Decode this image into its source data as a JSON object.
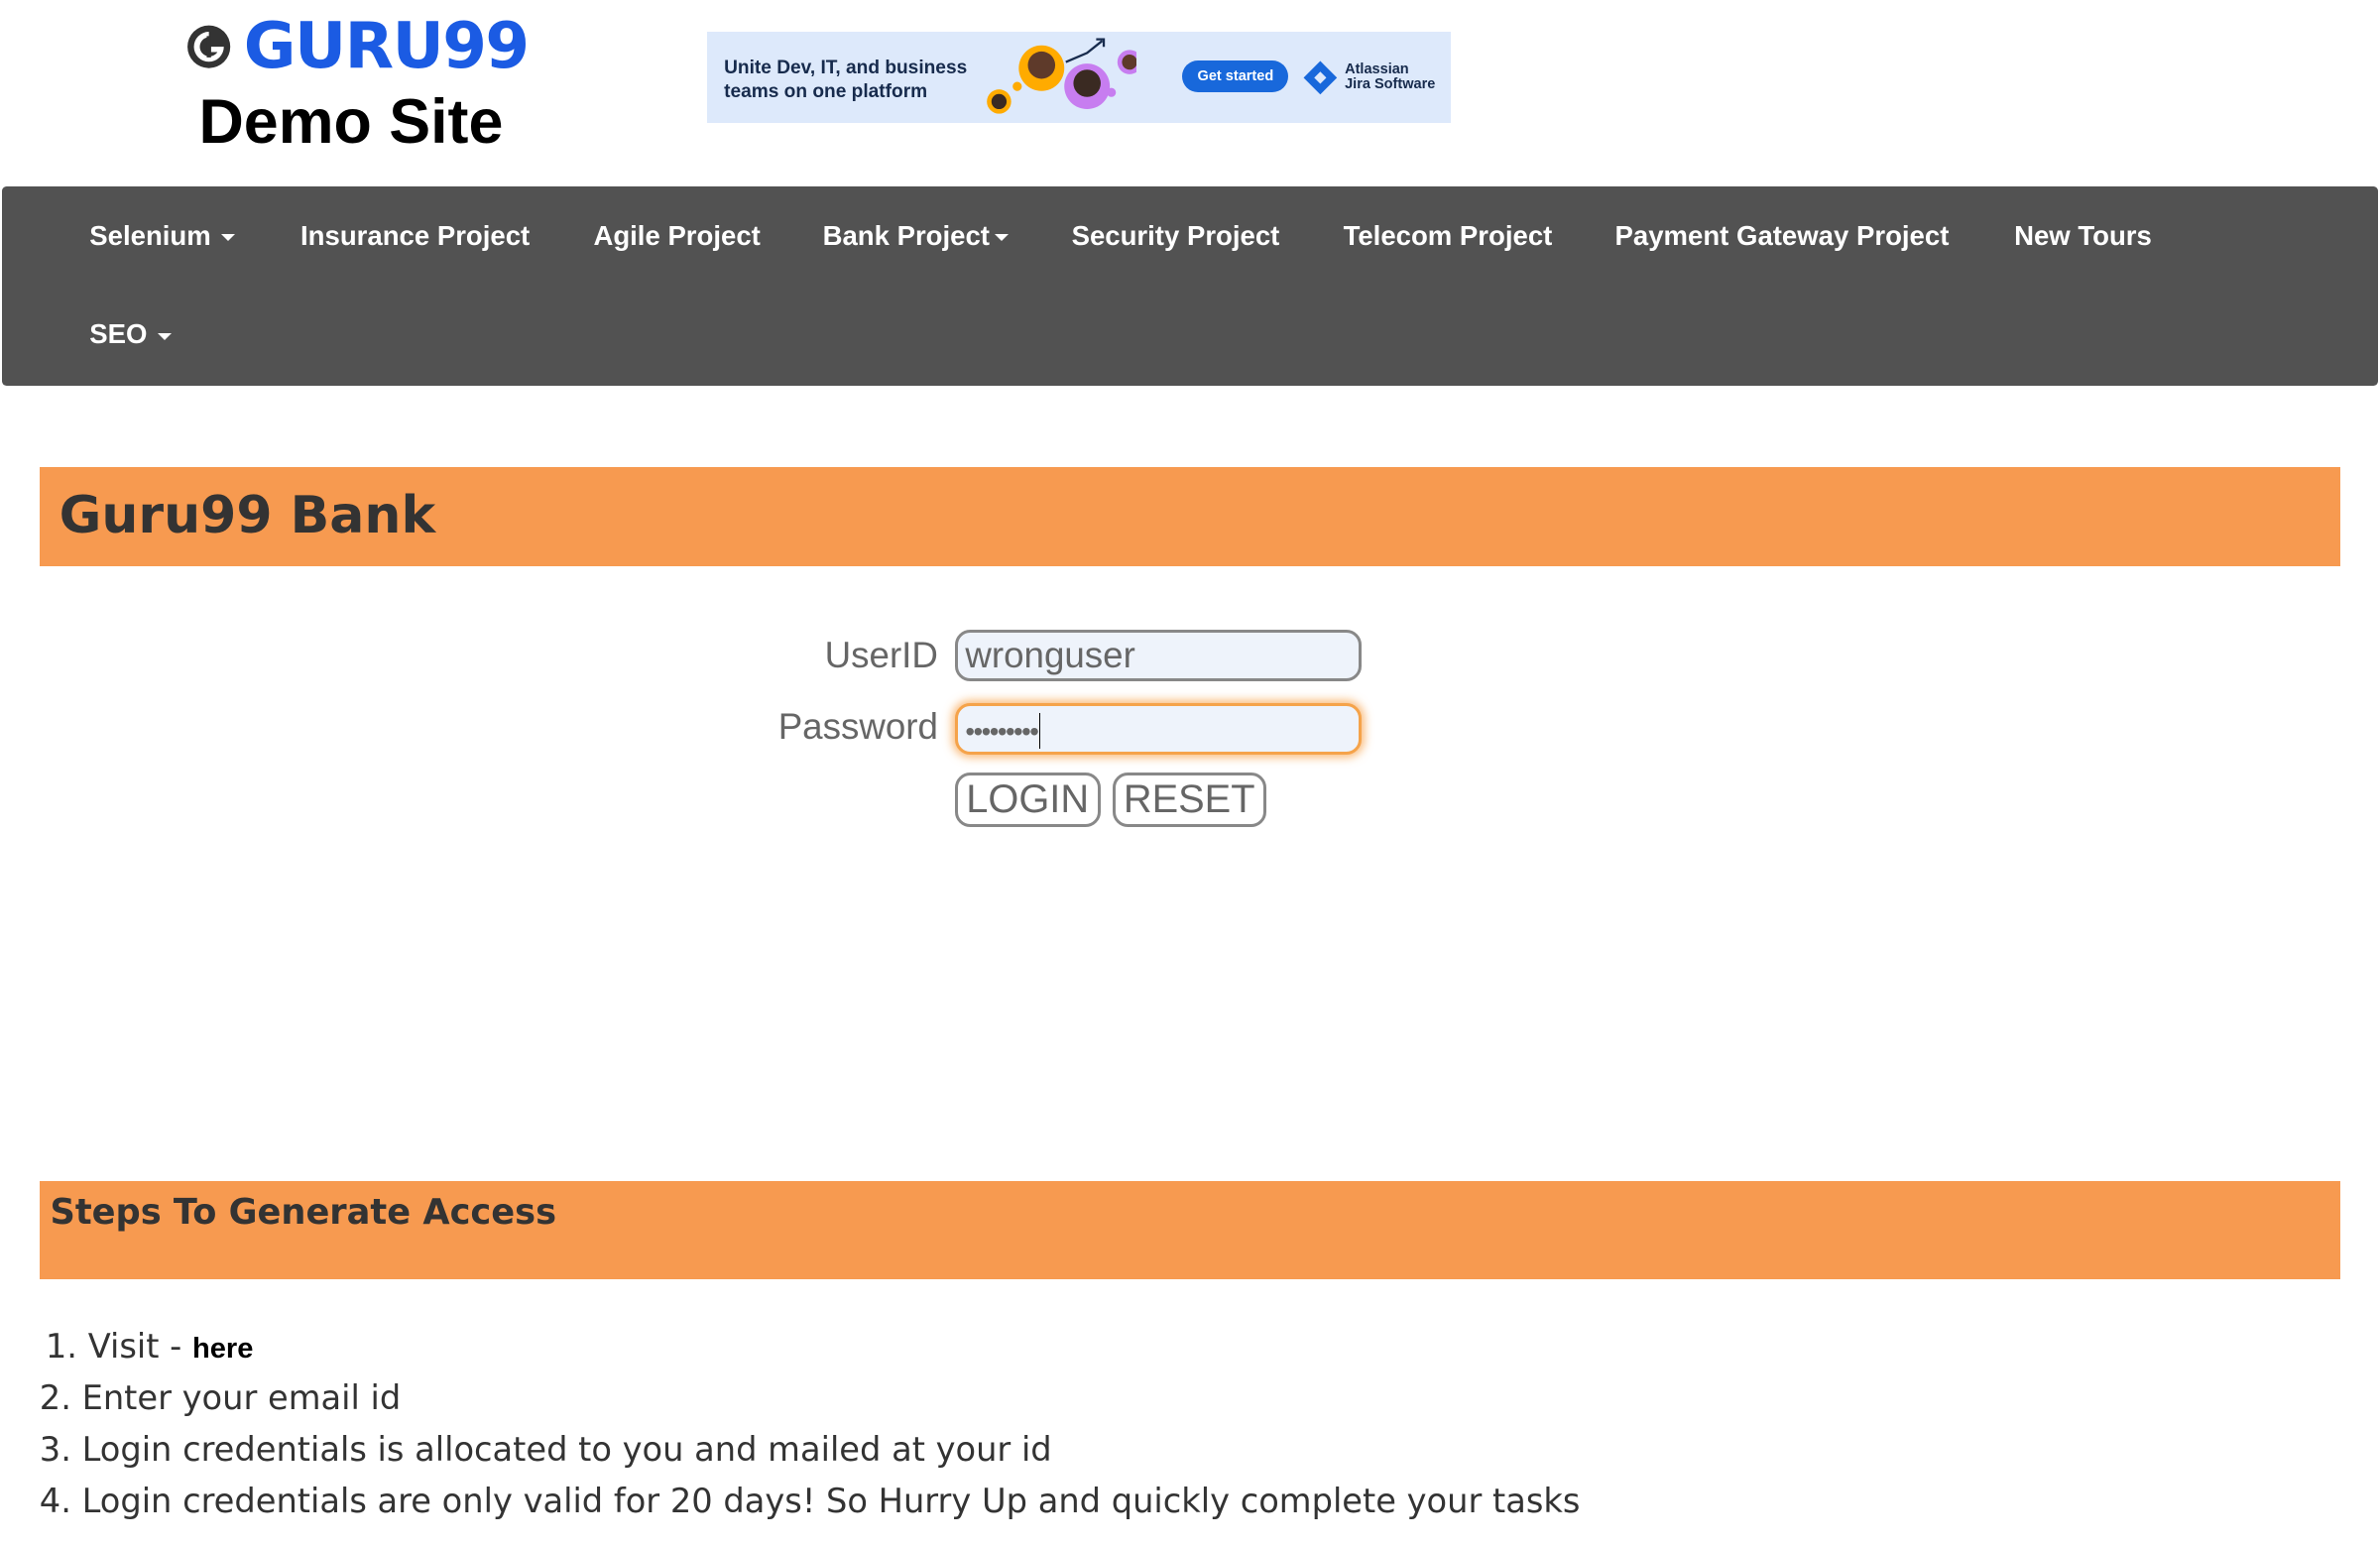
{
  "header": {
    "logo_text": "GURU99",
    "logo_subtitle": "Demo Site",
    "ad": {
      "headline": "Unite Dev, IT, and business teams on one platform",
      "button_label": "Get started",
      "brand_line1": "Atlassian",
      "brand_line2": "Jira Software"
    }
  },
  "nav": {
    "items": [
      {
        "label": "Selenium",
        "dropdown": true
      },
      {
        "label": "Insurance Project",
        "dropdown": false
      },
      {
        "label": "Agile Project",
        "dropdown": false
      },
      {
        "label": "Bank Project",
        "dropdown": true
      },
      {
        "label": "Security Project",
        "dropdown": false
      },
      {
        "label": "Telecom Project",
        "dropdown": false
      },
      {
        "label": "Payment Gateway Project",
        "dropdown": false
      },
      {
        "label": "New Tours",
        "dropdown": false
      },
      {
        "label": "SEO",
        "dropdown": true
      }
    ]
  },
  "bank": {
    "title": "Guru99 Bank",
    "userid_label": "UserID",
    "userid_value": "wronguser",
    "password_label": "Password",
    "password_value": "•••••••••",
    "login_label": "LOGIN",
    "reset_label": "RESET"
  },
  "steps": {
    "title": "Steps To Generate Access",
    "items": [
      "1. Visit - ",
      "2. Enter your email id",
      "3. Login credentials is allocated to you and mailed at your id",
      "4. Login credentials are only valid for 20 days! So Hurry Up and quickly complete your tasks"
    ],
    "here_link": "here"
  },
  "colors": {
    "nav_bg": "#525252",
    "band": "#f79a50",
    "logo_blue": "#1b5be3",
    "focus": "#f5a34a"
  }
}
